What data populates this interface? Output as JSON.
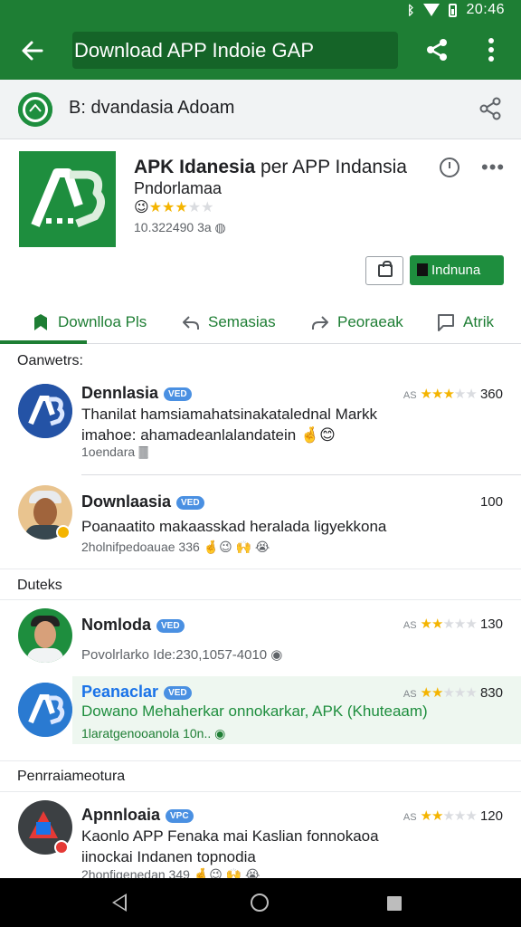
{
  "status_bar": {
    "time": "20:46"
  },
  "app_bar": {
    "search_text": "Download APP Indoie GAP"
  },
  "source": {
    "title": "B: dvandasia Adoam"
  },
  "app": {
    "name_bold": "APK Idanesia",
    "name_rest": " per APP Indansia",
    "developer": "Pndorlamaa",
    "rating_stars": "★★★",
    "rating_stars_off": "★★",
    "meta": "10.322490 3a ◍",
    "install_label": "Indnuna"
  },
  "tabs": [
    {
      "label": "Downlloa Pls"
    },
    {
      "label": "Semasias"
    },
    {
      "label": "Peoraeak"
    },
    {
      "label": "Atrik"
    }
  ],
  "sections": {
    "first": "Oanwetrs:",
    "second": "Duteks",
    "third": "Penrraiameotura"
  },
  "reviews": [
    {
      "name": "Dennlasia",
      "tag": "VED",
      "stars_label": "AS",
      "stars_on": "★★★",
      "stars_off": "★★",
      "score": "360",
      "text": "Thanilat hamsiamahatsinakatalednal Markk imahoe: ahamadeanlalandatein 🤞😊",
      "sub": "1oendara  🀫"
    },
    {
      "name": "Downlaasia",
      "tag": "VED",
      "score": "100",
      "text": "Poanaatito makaasskad heralada ligyekkona",
      "sub": "2holnifpedoauae 336 🤞😉 🙌 😭"
    },
    {
      "name": "Nomloda",
      "tag": "VED",
      "stars_label": "AS",
      "stars_on": "★★",
      "stars_off": "★★★",
      "score": "130",
      "sub": "Povolrlarko Ide:230,1057-4010 ◉"
    },
    {
      "name": "Peanaclar",
      "tag": "VED",
      "stars_label": "AS",
      "stars_on": "★★",
      "stars_off": "★★★",
      "score": "830",
      "text": "Dowano Mehaherkar onnokarkar, APK (Khuteaam)",
      "sub": "1laratgenooanola 10n.. ◉"
    },
    {
      "name": "Apnnloaia",
      "tag": "VPC",
      "stars_label": "AS",
      "stars_on": "★★",
      "stars_off": "★★★",
      "score": "120",
      "text": "Kaonlo APP Fenaka mai Kaslian fonnokaoa iinockai Indanen topnodia",
      "sub": "2honfigenedan 349 🤞😉 🙌 😭"
    }
  ]
}
